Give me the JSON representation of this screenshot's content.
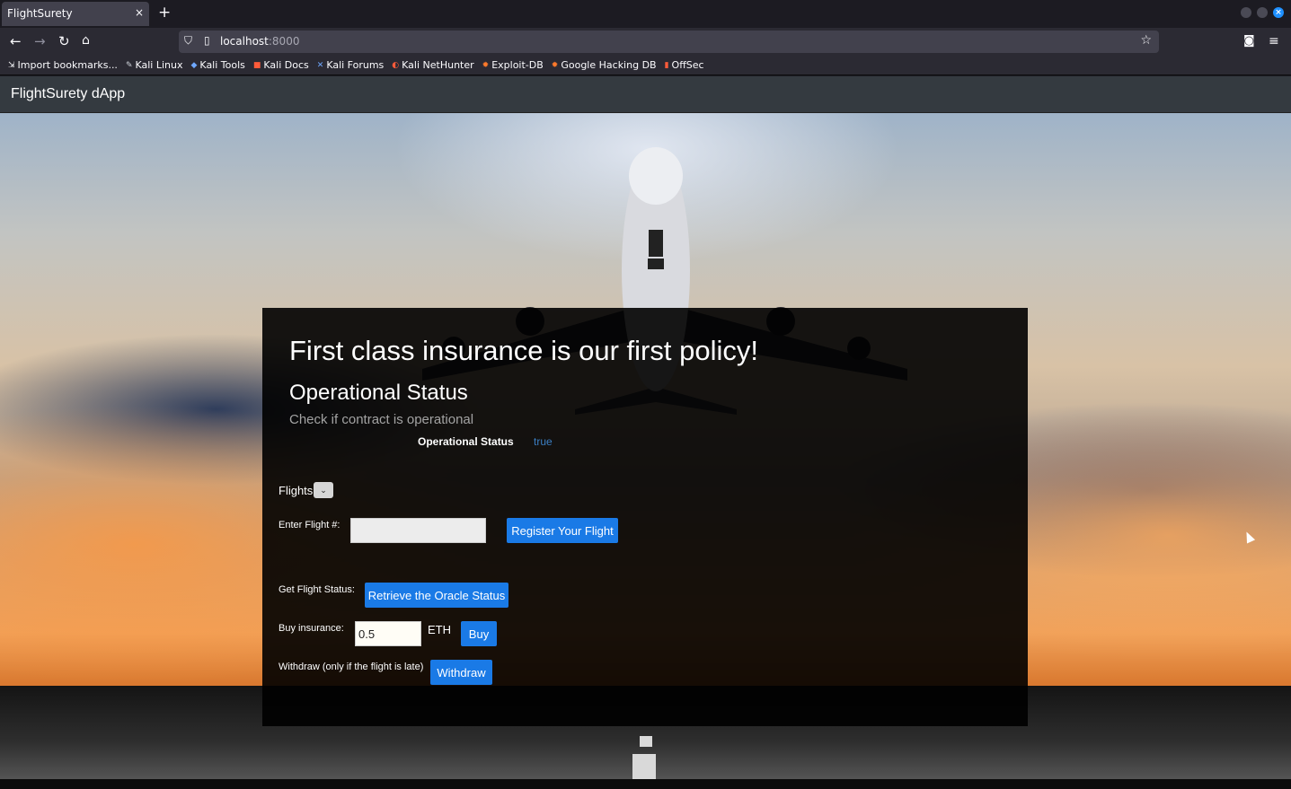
{
  "browser": {
    "tab_title": "FlightSurety",
    "tab_close": "×",
    "new_tab": "+",
    "url_host": "localhost",
    "url_port": ":8000",
    "bookmarks": [
      {
        "label": "Import bookmarks...",
        "icon": "import-icon"
      },
      {
        "label": "Kali Linux",
        "icon": "kali-dragon-icon"
      },
      {
        "label": "Kali Tools",
        "icon": "kali-tools-icon"
      },
      {
        "label": "Kali Docs",
        "icon": "kali-docs-icon"
      },
      {
        "label": "Kali Forums",
        "icon": "kali-forums-icon"
      },
      {
        "label": "Kali NetHunter",
        "icon": "nethunter-icon"
      },
      {
        "label": "Exploit-DB",
        "icon": "exploit-db-icon"
      },
      {
        "label": "Google Hacking DB",
        "icon": "ghdb-icon"
      },
      {
        "label": "OffSec",
        "icon": "offsec-icon"
      }
    ]
  },
  "app": {
    "brand": "FlightSurety dApp",
    "headline": "First class insurance is our first policy!",
    "section_title": "Operational Status",
    "section_subtitle": "Check if contract is operational",
    "status_label": "Operational Status",
    "status_value": "true",
    "flights_label": "Flights",
    "flights_toggle": "⌄",
    "flight_number_label": "Enter Flight #:",
    "flight_number_value": "",
    "register_button": "Register Your Flight",
    "status_request_label": "Get Flight Status:",
    "oracle_button": "Retrieve the Oracle Status",
    "buy_label": "Buy insurance:",
    "buy_amount": "0.5",
    "currency": "ETH",
    "buy_button": "Buy",
    "withdraw_label": "Withdraw (only if the flight is late)",
    "withdraw_button": "Withdraw"
  },
  "colors": {
    "app_navbar": "#343a40",
    "primary_button": "#1a7ae6",
    "status_value": "#3b7fc4",
    "browser_chrome": "#2b2a33"
  }
}
